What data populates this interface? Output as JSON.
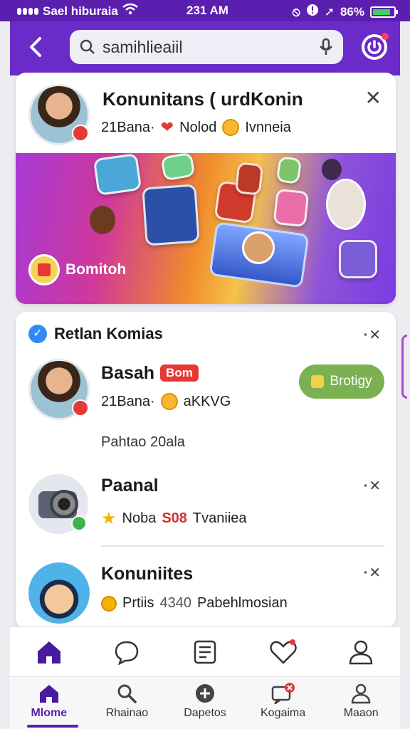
{
  "status_bar": {
    "carrier": "Sael hiburaia",
    "time": "231 AM",
    "battery": "86%"
  },
  "search": {
    "query": "samihlieaiil"
  },
  "top_card": {
    "title": "Konunitans ( urdKonin",
    "meta_count": "21Bana·",
    "meta_label1": "Nolod",
    "meta_label2": "Ivnneia",
    "banner_button": "Bomitoh"
  },
  "section": {
    "title": "Retlan Komias",
    "items": [
      {
        "name": "Basah",
        "tag": "Bom",
        "meta_count": "21Bana·",
        "meta_label": "aKKVG",
        "button": "Brotigy",
        "subtitle": "Pahtao 20ala"
      },
      {
        "name": "Paanal",
        "meta_label1": "Noba",
        "meta_num": "S08",
        "meta_label2": "Tvaniiea"
      },
      {
        "name": "Konuniites",
        "meta_label1": "Prtiis",
        "meta_num": "4340",
        "meta_label2": "Pabehlmosian"
      }
    ]
  },
  "bottom_nav": {
    "items": [
      {
        "label": "Mlome",
        "icon": "home-icon"
      },
      {
        "label": "Rhainao",
        "icon": "search-icon"
      },
      {
        "label": "Dapetos",
        "icon": "plus-circle-icon"
      },
      {
        "label": "Kogaima",
        "icon": "chat-badge-icon"
      },
      {
        "label": "Maaon",
        "icon": "profile-icon"
      }
    ]
  },
  "colors": {
    "brand": "#5b1fb0",
    "header": "#6a2bc9",
    "follow": "#7cb152",
    "accent_red": "#e53935"
  }
}
